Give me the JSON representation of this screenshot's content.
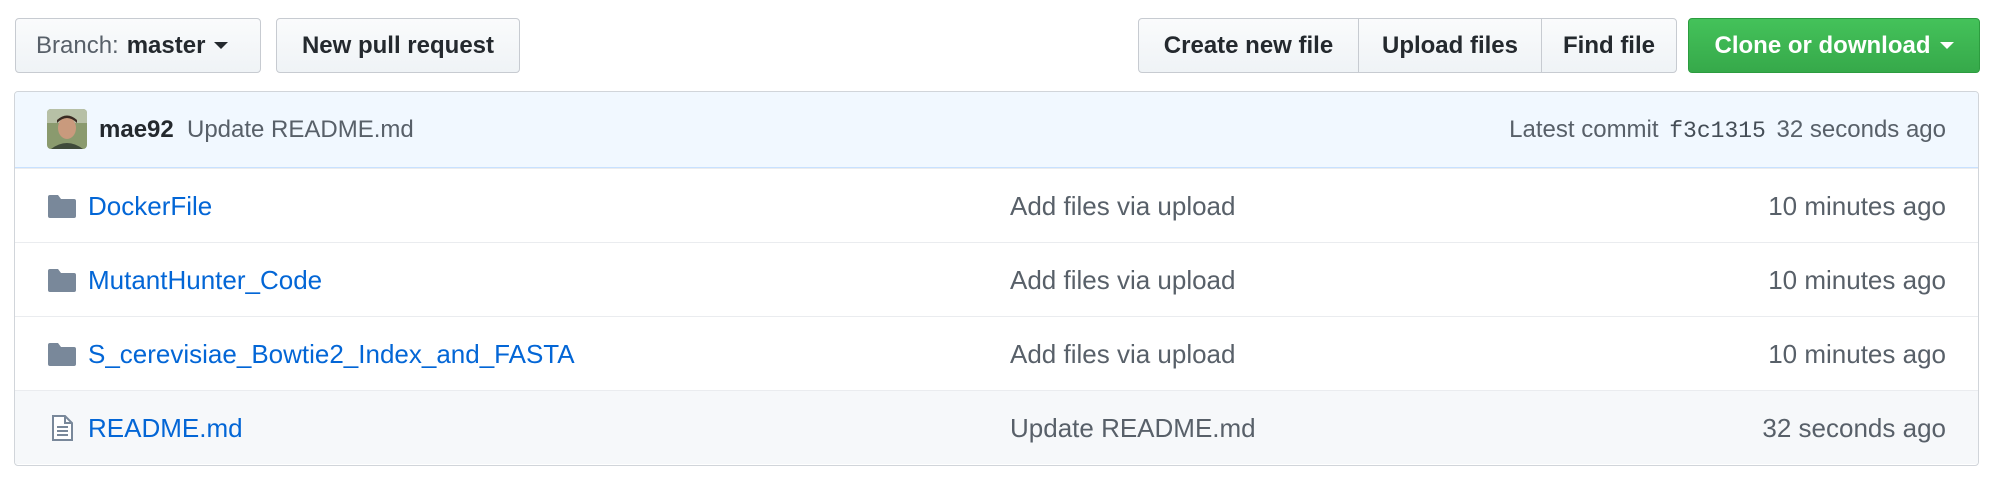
{
  "toolbar": {
    "branch_label": "Branch:",
    "branch_value": "master",
    "new_pr": "New pull request",
    "create_file": "Create new file",
    "upload_files": "Upload files",
    "find_file": "Find file",
    "clone": "Clone or download"
  },
  "commit": {
    "author": "mae92",
    "message": "Update README.md",
    "latest_label": "Latest commit",
    "sha": "f3c1315",
    "time": "32 seconds ago"
  },
  "files": [
    {
      "name": "DockerFile",
      "type": "folder-icon",
      "message": "Add files via upload",
      "age": "10 minutes ago"
    },
    {
      "name": "MutantHunter_Code",
      "type": "folder-icon",
      "message": "Add files via upload",
      "age": "10 minutes ago"
    },
    {
      "name": "S_cerevisiae_Bowtie2_Index_and_FASTA",
      "type": "folder-icon",
      "message": "Add files via upload",
      "age": "10 minutes ago"
    },
    {
      "name": "README.md",
      "type": "file-icon",
      "message": "Update README.md",
      "age": "32 seconds ago"
    }
  ],
  "colors": {
    "link": "#0366d6",
    "clone_button": "#36a94a",
    "commit_bar_bg": "#f1f8ff",
    "folder_icon": "#79889a"
  }
}
